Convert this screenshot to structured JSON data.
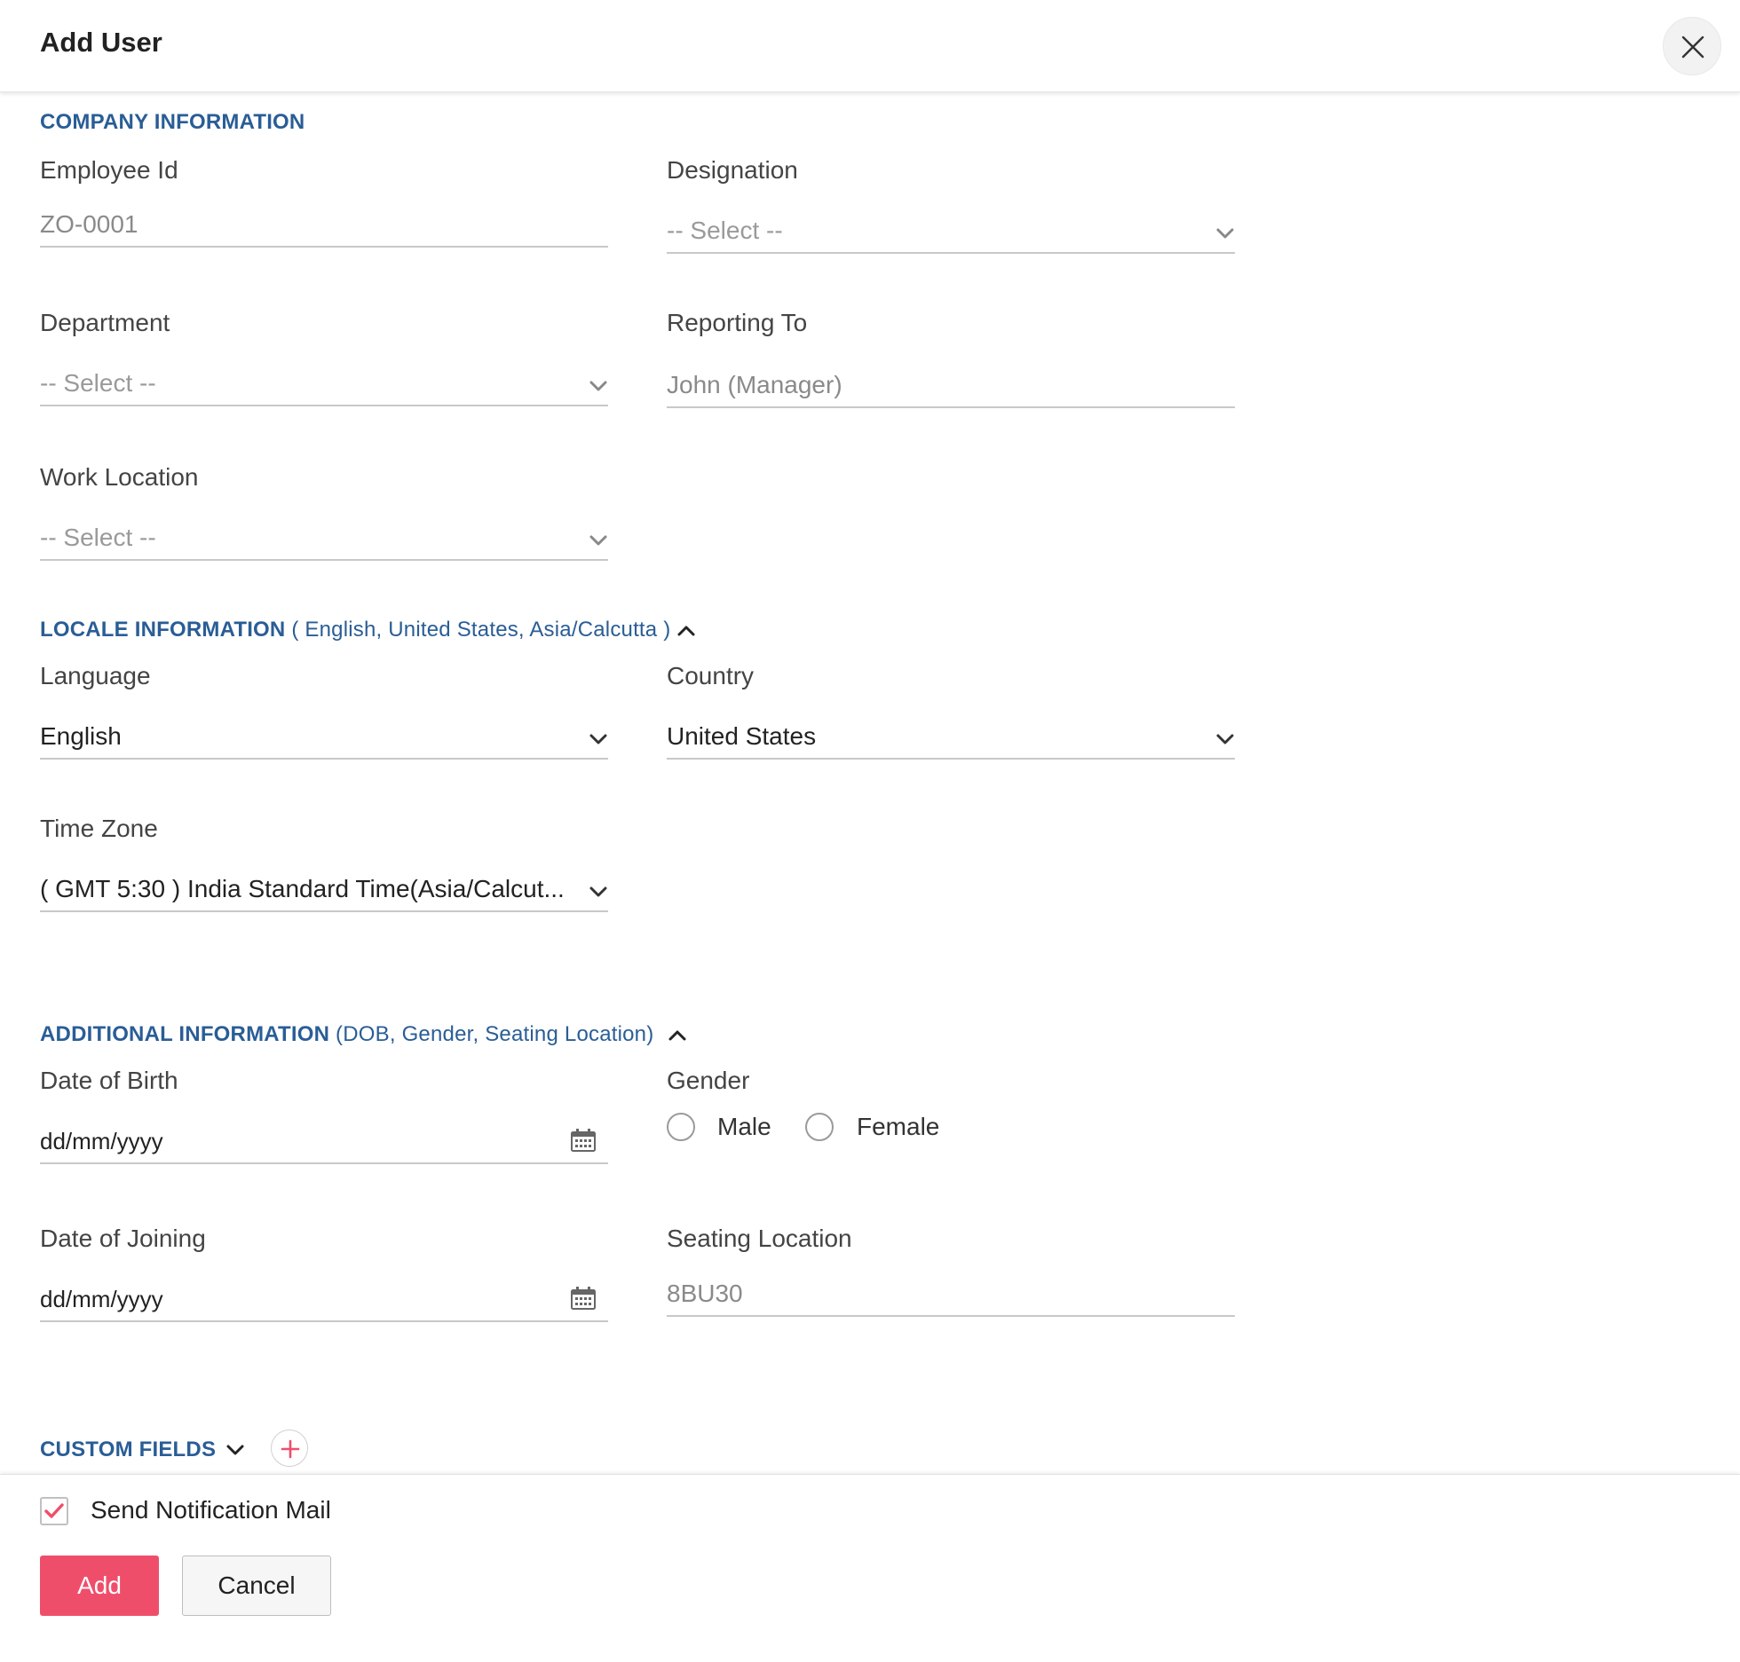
{
  "header": {
    "title": "Add User"
  },
  "company": {
    "title": "COMPANY INFORMATION",
    "employee_id": {
      "label": "Employee Id",
      "value": "ZO-0001"
    },
    "designation": {
      "label": "Designation",
      "value": "-- Select --"
    },
    "department": {
      "label": "Department",
      "value": "-- Select --"
    },
    "reporting_to": {
      "label": "Reporting To",
      "value": "John (Manager)"
    },
    "work_location": {
      "label": "Work Location",
      "value": "-- Select --"
    }
  },
  "locale": {
    "title": "LOCALE INFORMATION",
    "summary": "( English, United States, Asia/Calcutta )",
    "language": {
      "label": "Language",
      "value": "English"
    },
    "country": {
      "label": "Country",
      "value": "United States"
    },
    "time_zone": {
      "label": "Time Zone",
      "value": "( GMT 5:30 ) India Standard Time(Asia/Calcut..."
    }
  },
  "additional": {
    "title": "ADDITIONAL INFORMATION",
    "summary": "(DOB, Gender, Seating Location)",
    "dob": {
      "label": "Date of Birth",
      "value": "dd/mm/yyyy"
    },
    "gender": {
      "label": "Gender",
      "options": [
        "Male",
        "Female"
      ],
      "selected": null
    },
    "doj": {
      "label": "Date of Joining",
      "value": "dd/mm/yyyy"
    },
    "seating": {
      "label": "Seating Location",
      "value": "8BU30"
    }
  },
  "custom_fields": {
    "title": "CUSTOM FIELDS"
  },
  "footer": {
    "notify_label": "Send Notification Mail",
    "notify_checked": true,
    "add_label": "Add",
    "cancel_label": "Cancel"
  },
  "colors": {
    "section_title": "#2a5d96",
    "primary_button": "#ef4e6b",
    "field_border": "#c8c8c8"
  },
  "icons": {
    "close": "close-icon",
    "dropdown": "chevron-down-icon",
    "collapse": "chevron-up-icon",
    "calendar": "calendar-icon",
    "add": "plus-icon",
    "check": "checkmark-icon"
  }
}
